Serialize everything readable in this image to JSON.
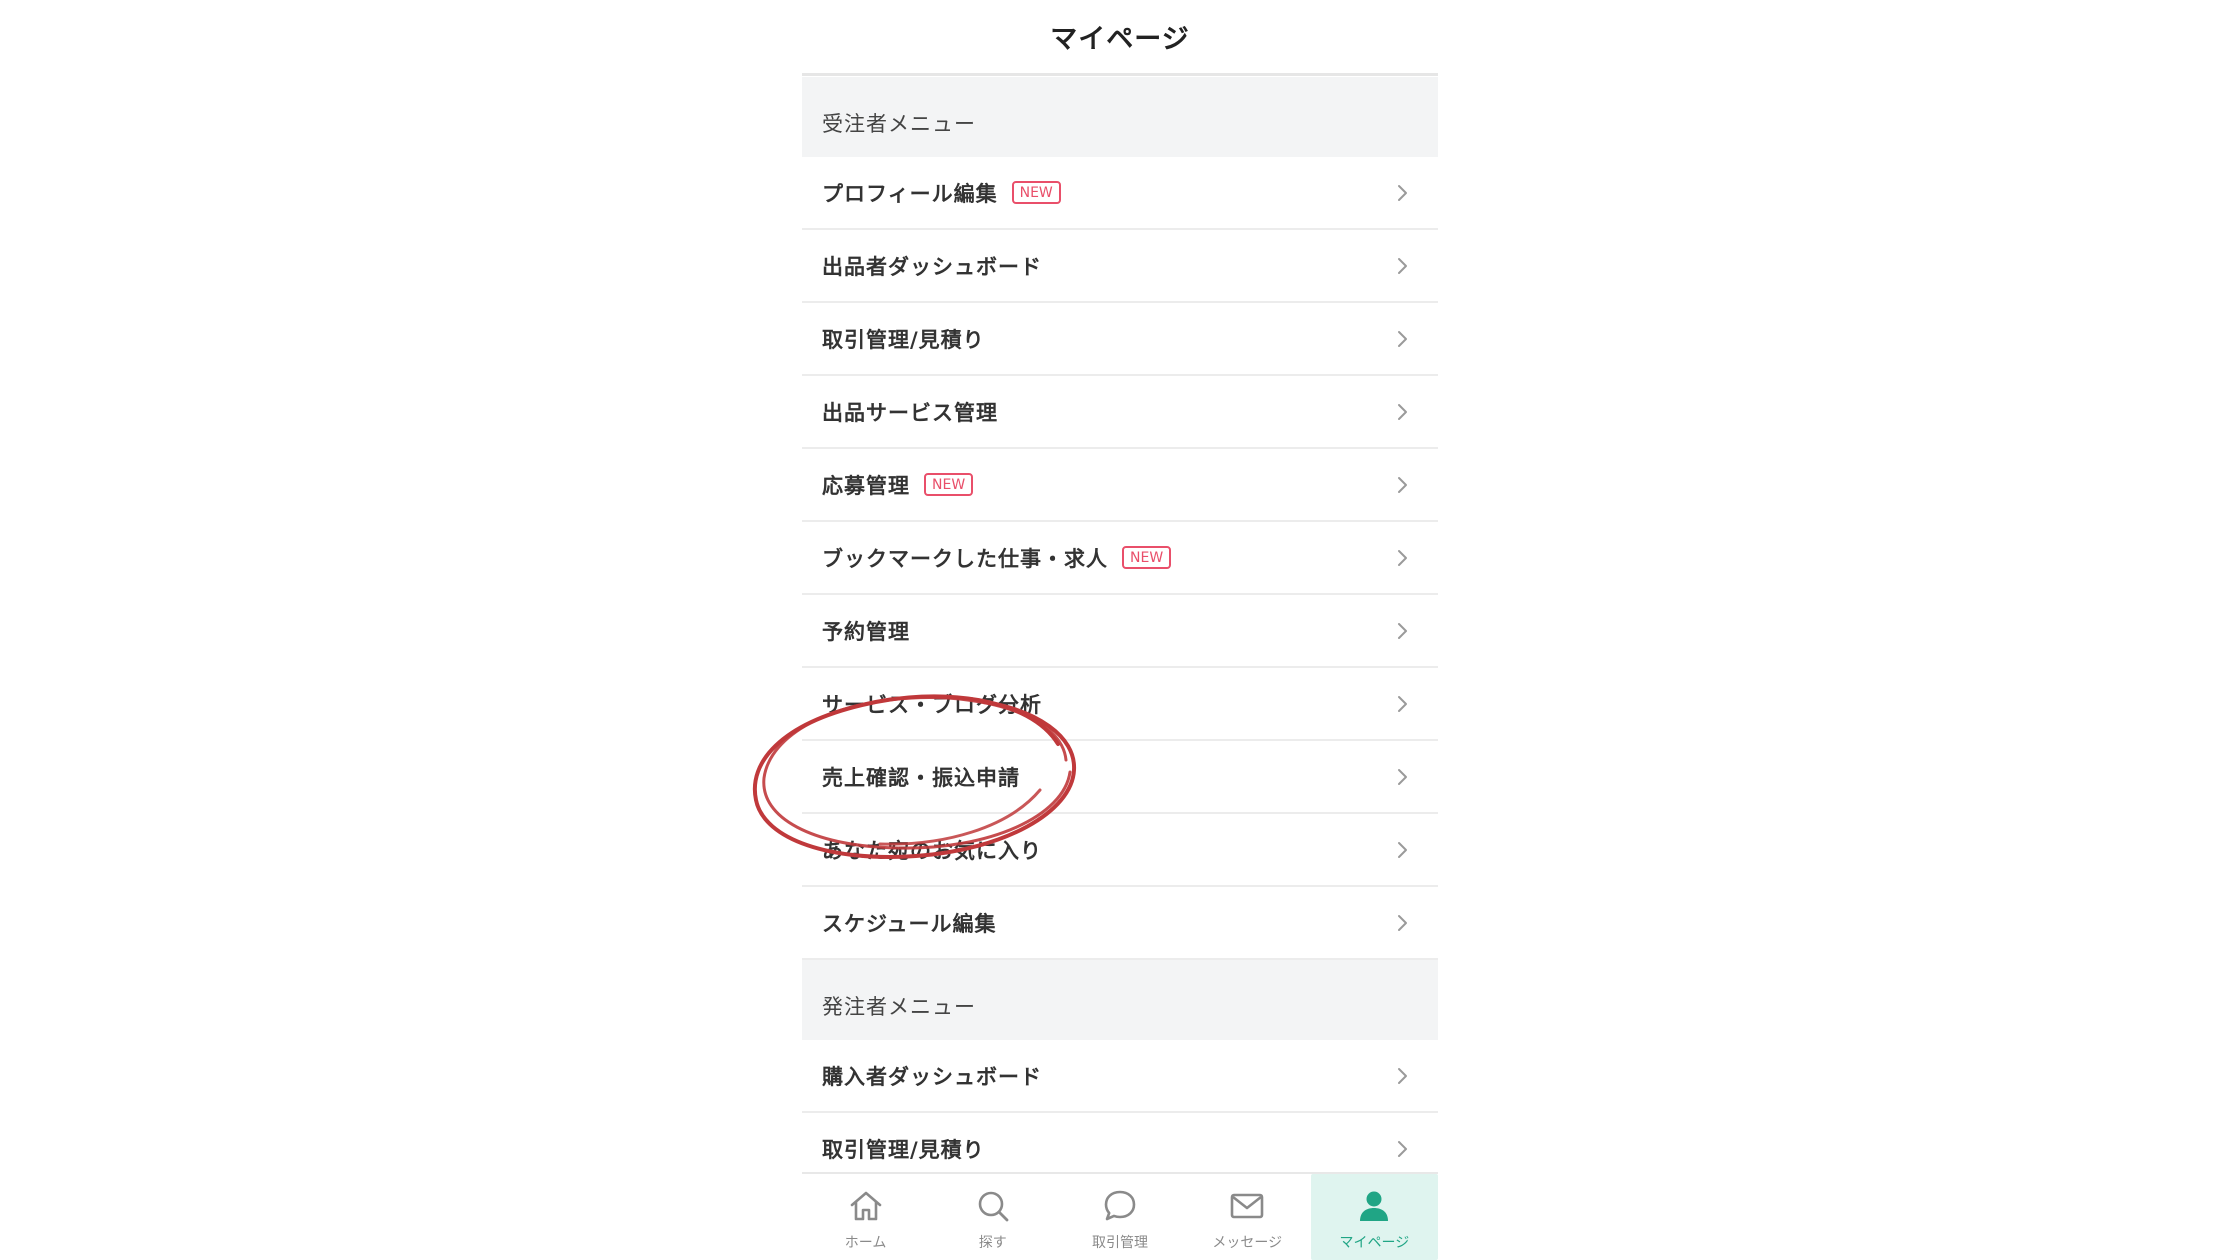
{
  "page": {
    "title": "マイページ"
  },
  "menu": {
    "seller_header": "受注者メニュー",
    "seller_items": [
      {
        "label": "プロフィール編集",
        "badge": "NEW"
      },
      {
        "label": "出品者ダッシュボード"
      },
      {
        "label": "取引管理/見積り"
      },
      {
        "label": "出品サービス管理"
      },
      {
        "label": "応募管理",
        "badge": "NEW"
      },
      {
        "label": "ブックマークした仕事・求人",
        "badge": "NEW"
      },
      {
        "label": "予約管理"
      },
      {
        "label": "サービス・ブログ分析"
      },
      {
        "label": "売上確認・振込申請"
      },
      {
        "label": "あなた宛のお気に入り"
      },
      {
        "label": "スケジュール編集"
      }
    ],
    "buyer_header": "発注者メニュー",
    "buyer_items": [
      {
        "label": "購入者ダッシュボード"
      },
      {
        "label": "取引管理/見積り"
      }
    ]
  },
  "tabbar": {
    "tabs": [
      {
        "label": "ホーム",
        "icon": "home-icon"
      },
      {
        "label": "探す",
        "icon": "search-icon"
      },
      {
        "label": "取引管理",
        "icon": "chat-bubble-icon"
      },
      {
        "label": "メッセージ",
        "icon": "mail-icon"
      },
      {
        "label": "マイページ",
        "icon": "person-icon",
        "active": true
      }
    ]
  },
  "colors": {
    "accent": "#20a585",
    "active_tab_bg": "#dff4ef",
    "badge": "#e94f6a",
    "annotation_circle": "#c0393b",
    "section_bg": "#f3f4f5"
  }
}
